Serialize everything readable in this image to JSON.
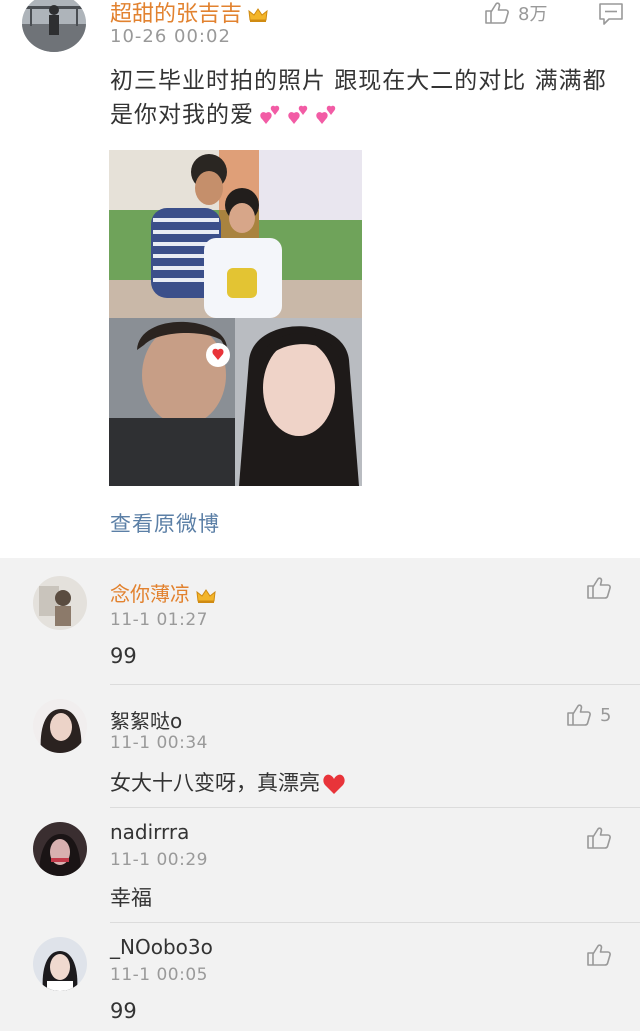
{
  "post": {
    "username": "超甜的张吉吉",
    "time": "10-26 00:02",
    "like_count": "8万",
    "text": "初三毕业时拍的照片  跟现在大二的对比  满满都是你对我的爱",
    "view_original": "查看原微博"
  },
  "comments": [
    {
      "username": "念你薄凉",
      "time": "11-1 01:27",
      "text": "99",
      "like_count": ""
    },
    {
      "username": "絮絮哒o",
      "time": "11-1 00:34",
      "text": "女大十八变呀，真漂亮",
      "like_count": "5"
    },
    {
      "username": "nadirrra",
      "time": "11-1 00:29",
      "text": "幸福",
      "like_count": ""
    },
    {
      "username": "_NOobo3o",
      "time": "11-1 00:05",
      "text": "99",
      "like_count": ""
    }
  ],
  "colors": {
    "accent_gold": "#e2822f",
    "link_blue": "#5b7fa6",
    "heart_pink": "#f25ca5",
    "heart_red": "#e8343a"
  },
  "icons": [
    "thumbs-up-icon",
    "reply-icon",
    "crown-badge-icon",
    "pink-hearts-icon",
    "red-heart-icon"
  ]
}
